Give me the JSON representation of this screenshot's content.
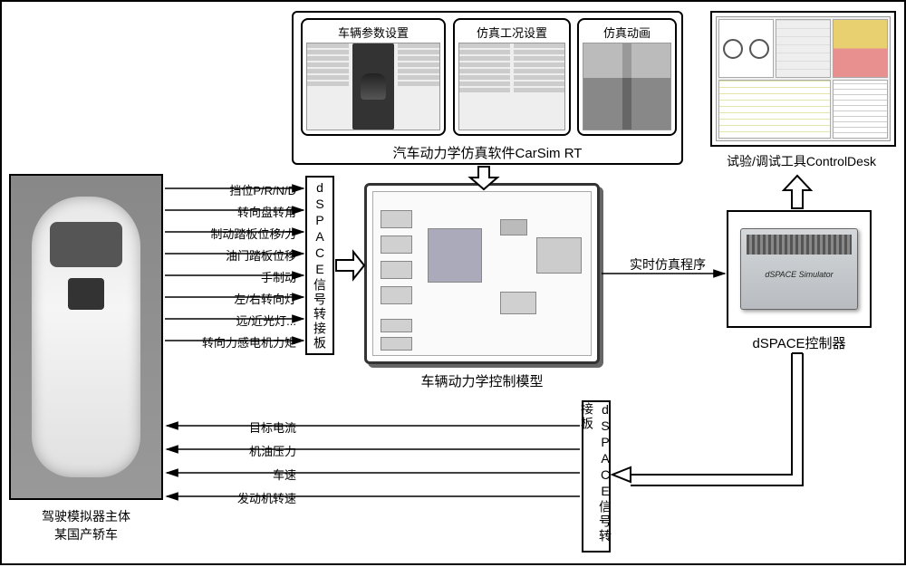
{
  "car": {
    "label_line1": "驾驶模拟器主体",
    "label_line2": "某国产轿车"
  },
  "signals_out": [
    "挡位P/R/N/D",
    "转向盘转角",
    "制动踏板位移/力",
    "油门踏板位移",
    "手制动",
    "左/右转向灯",
    "远/近光灯...",
    "转向力感电机力矩"
  ],
  "signals_in": [
    "目标电流",
    "机油压力",
    "车速",
    "发动机转速"
  ],
  "board_label": "dSPACE信号转接板",
  "carsim": {
    "tab1": "车辆参数设置",
    "tab2": "仿真工况设置",
    "tab3": "仿真动画",
    "group_label": "汽车动力学仿真软件CarSim RT"
  },
  "simulink_label": "车辆动力学控制模型",
  "realtime_arrow": "实时仿真程序",
  "dspace_controller_label": "dSPACE控制器",
  "controldesk_label": "试验/调试工具ControlDesk"
}
